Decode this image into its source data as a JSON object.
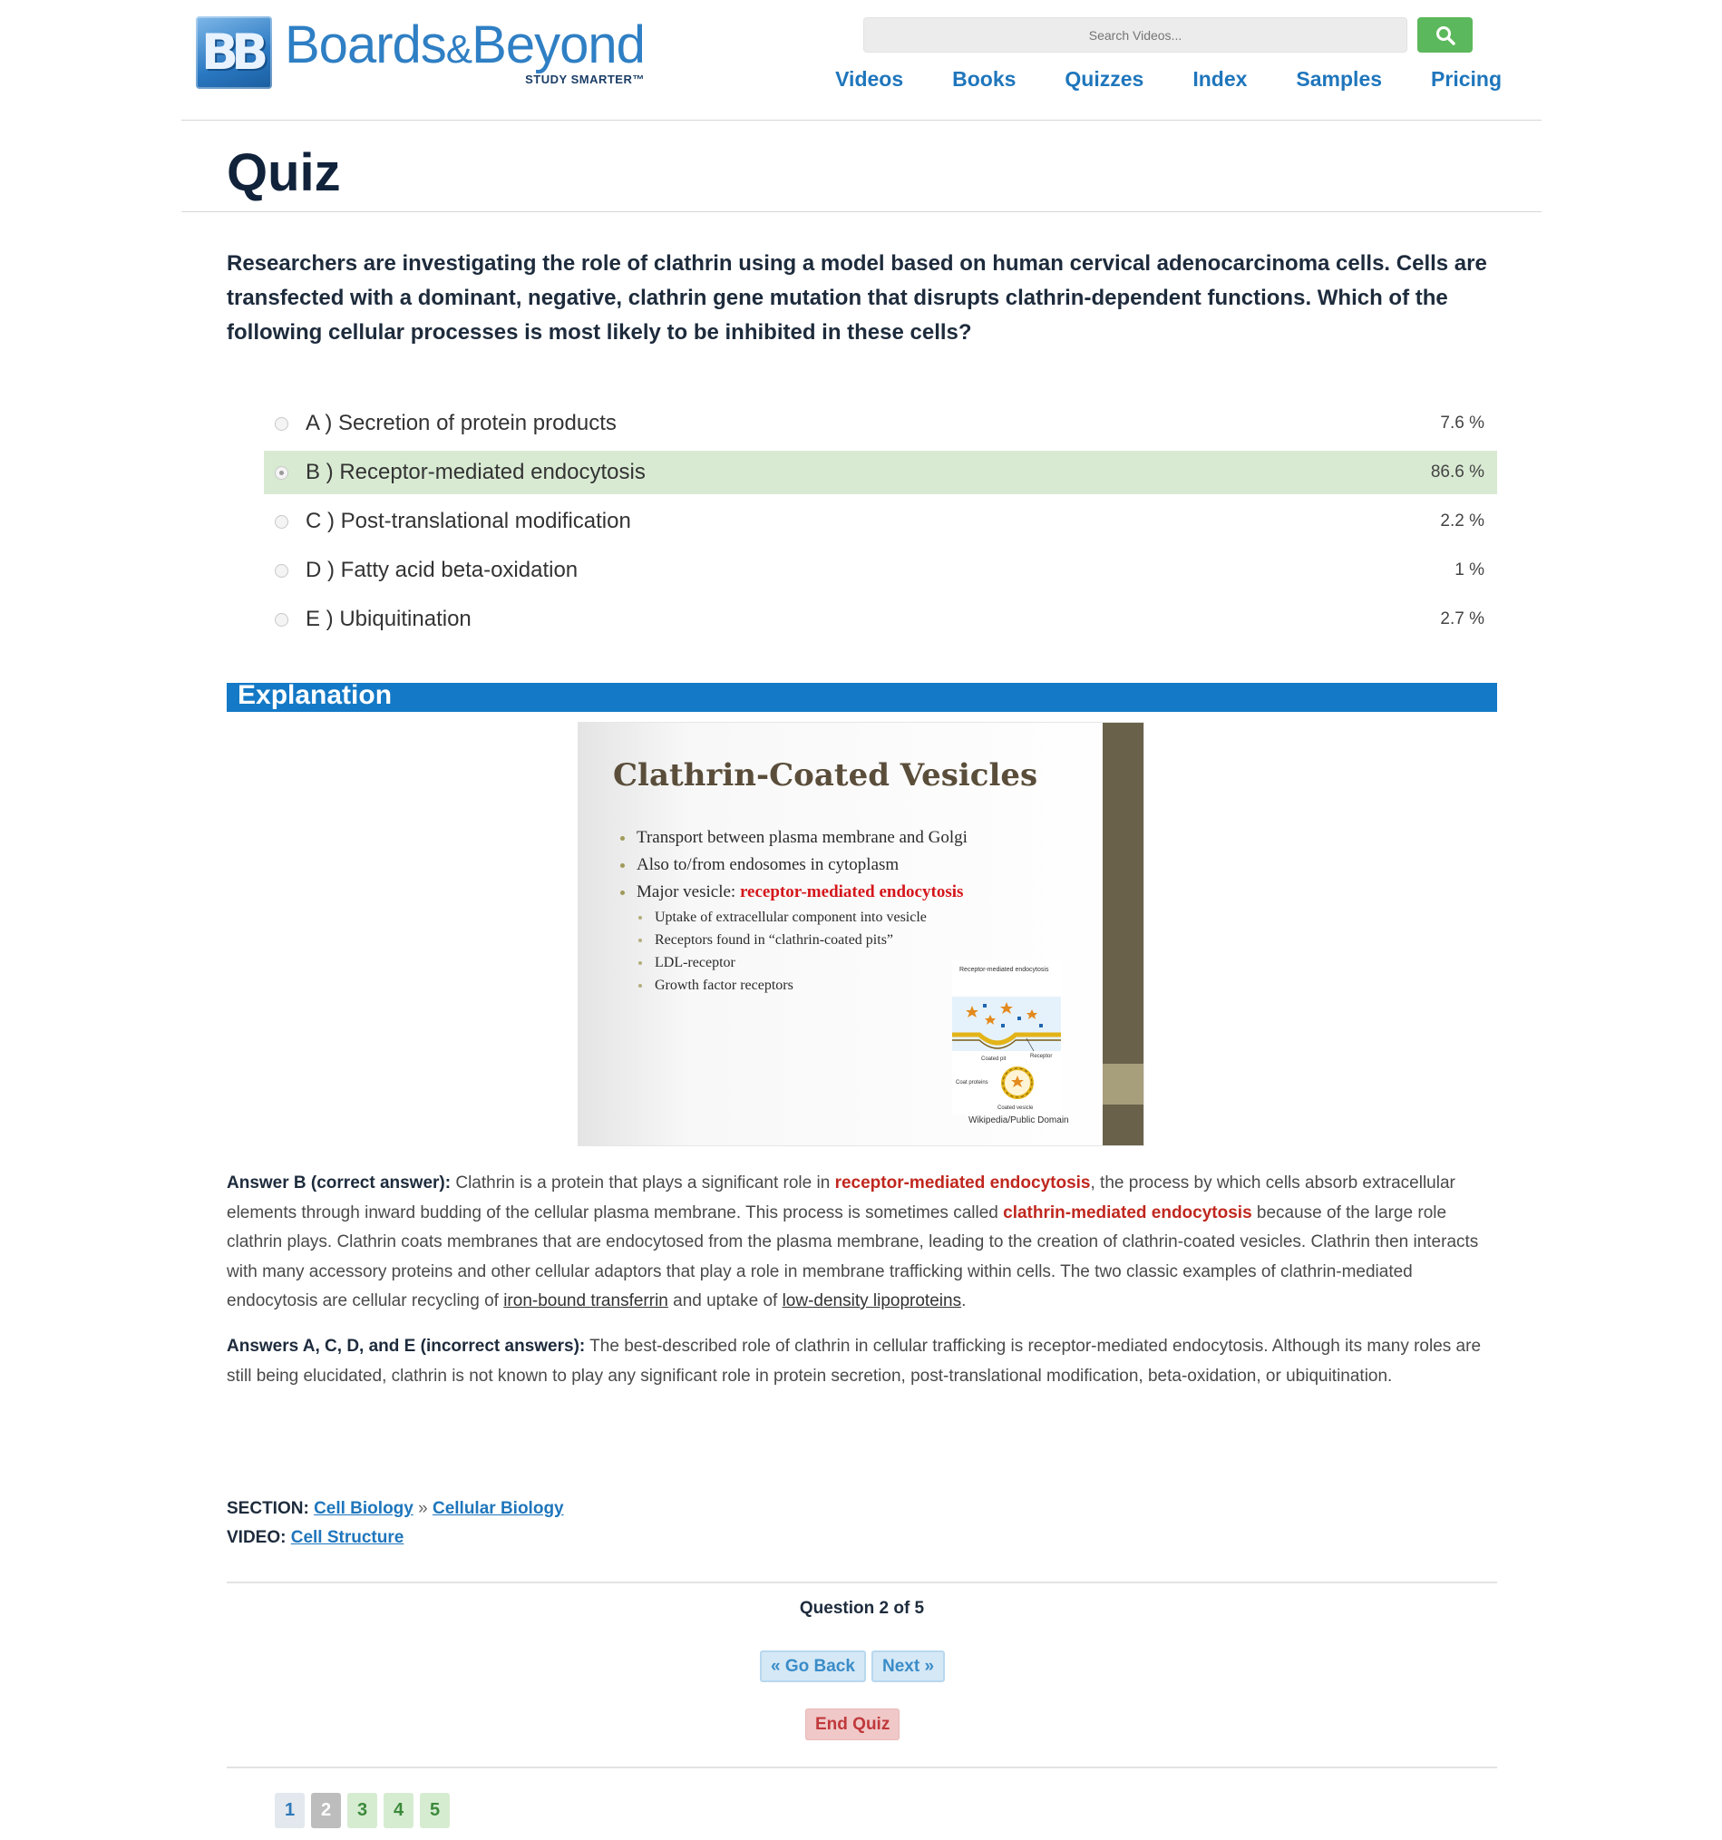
{
  "header": {
    "brand": "Boards",
    "brand_amp": "&",
    "brand_rest": "Beyond",
    "tagline": "STUDY SMARTER™",
    "search_placeholder": "Search Videos...",
    "nav": [
      "Videos",
      "Books",
      "Quizzes",
      "Index",
      "Samples",
      "Pricing"
    ]
  },
  "page": {
    "title": "Quiz"
  },
  "question": {
    "text": "Researchers are investigating the role of clathrin using a model based on human cervical adenocarcinoma cells. Cells are transfected with a dominant, negative, clathrin gene mutation that disrupts clathrin-dependent functions. Which of the following cellular processes is most likely to be inhibited in these cells?"
  },
  "options": [
    {
      "label": "A ) Secretion of protein products",
      "pct": "7.6 %"
    },
    {
      "label": "B ) Receptor-mediated endocytosis",
      "pct": "86.6 %"
    },
    {
      "label": "C ) Post-translational modification",
      "pct": "2.2 %"
    },
    {
      "label": "D ) Fatty acid beta-oxidation",
      "pct": "1 %"
    },
    {
      "label": "E ) Ubiquitination",
      "pct": "2.7 %"
    }
  ],
  "selected_option": "B",
  "explanation": {
    "heading": "Explanation",
    "slide": {
      "title": "Clathrin-Coated Vesicles",
      "bullet1": "Transport between plasma membrane and Golgi",
      "bullet2": "Also to/from endosomes in cytoplasm",
      "bullet3_prefix": "Major vesicle: ",
      "bullet3_highlight": "receptor-mediated endocytosis",
      "sub1": "Uptake of extracellular component into vesicle",
      "sub2": "Receptors found in “clathrin-coated pits”",
      "sub3": "LDL-receptor",
      "sub4": "Growth factor receptors",
      "diagram_title": "Receptor-mediated endocytosis",
      "diagram_pit": "Coated pit",
      "diagram_receptor": "Receptor",
      "diagram_coat": "Coat proteins",
      "diagram_vesicle": "Coated vesicle",
      "credit": "Wikipedia/Public Domain"
    },
    "correct": {
      "lead": "Answer B (correct answer):",
      "t1": " Clathrin is a protein that plays a significant role in ",
      "h1": "receptor-mediated endocytosis",
      "t2": ", the process by which cells absorb extracellular elements through inward budding of the cellular plasma membrane. This process is sometimes called ",
      "h2": "clathrin-mediated endocytosis",
      "t3": " because of the large role clathrin plays. Clathrin coats membranes that are endocytosed from the plasma membrane, leading to the creation of clathrin-coated vesicles. Clathrin then interacts with many accessory proteins and other cellular adaptors that play a role in membrane trafficking within cells. The two classic examples of clathrin-mediated endocytosis are cellular recycling of ",
      "u1": "iron-bound transferrin",
      "t4": " and uptake of ",
      "u2": "low-density lipoproteins",
      "t5": "."
    },
    "incorrect": {
      "lead": "Answers A, C, D, and E (incorrect answers):",
      "text": " The best-described role of clathrin in cellular trafficking is receptor-mediated endocytosis. Although its many roles are still being elucidated, clathrin is not known to play any significant role in protein secretion, post-translational modification, beta-oxidation, or ubiquitination."
    }
  },
  "meta": {
    "section_label": "SECTION:",
    "section_link1": "Cell Biology",
    "section_sep": " » ",
    "section_link2": "Cellular Biology",
    "video_label": "VIDEO:",
    "video_link": "Cell Structure"
  },
  "navigation": {
    "question_count": "Question 2 of 5",
    "go_back": "« Go Back",
    "next": "Next »",
    "end_quiz": "End Quiz",
    "pages": [
      "1",
      "2",
      "3",
      "4",
      "5"
    ],
    "current_page": "2"
  },
  "colors": {
    "brand_blue": "#1f76bc",
    "explanation_bar": "#1479c6",
    "selected_option_bg": "#d9ead3",
    "search_button": "#5cb85c",
    "highlight_red": "#c0271e"
  }
}
